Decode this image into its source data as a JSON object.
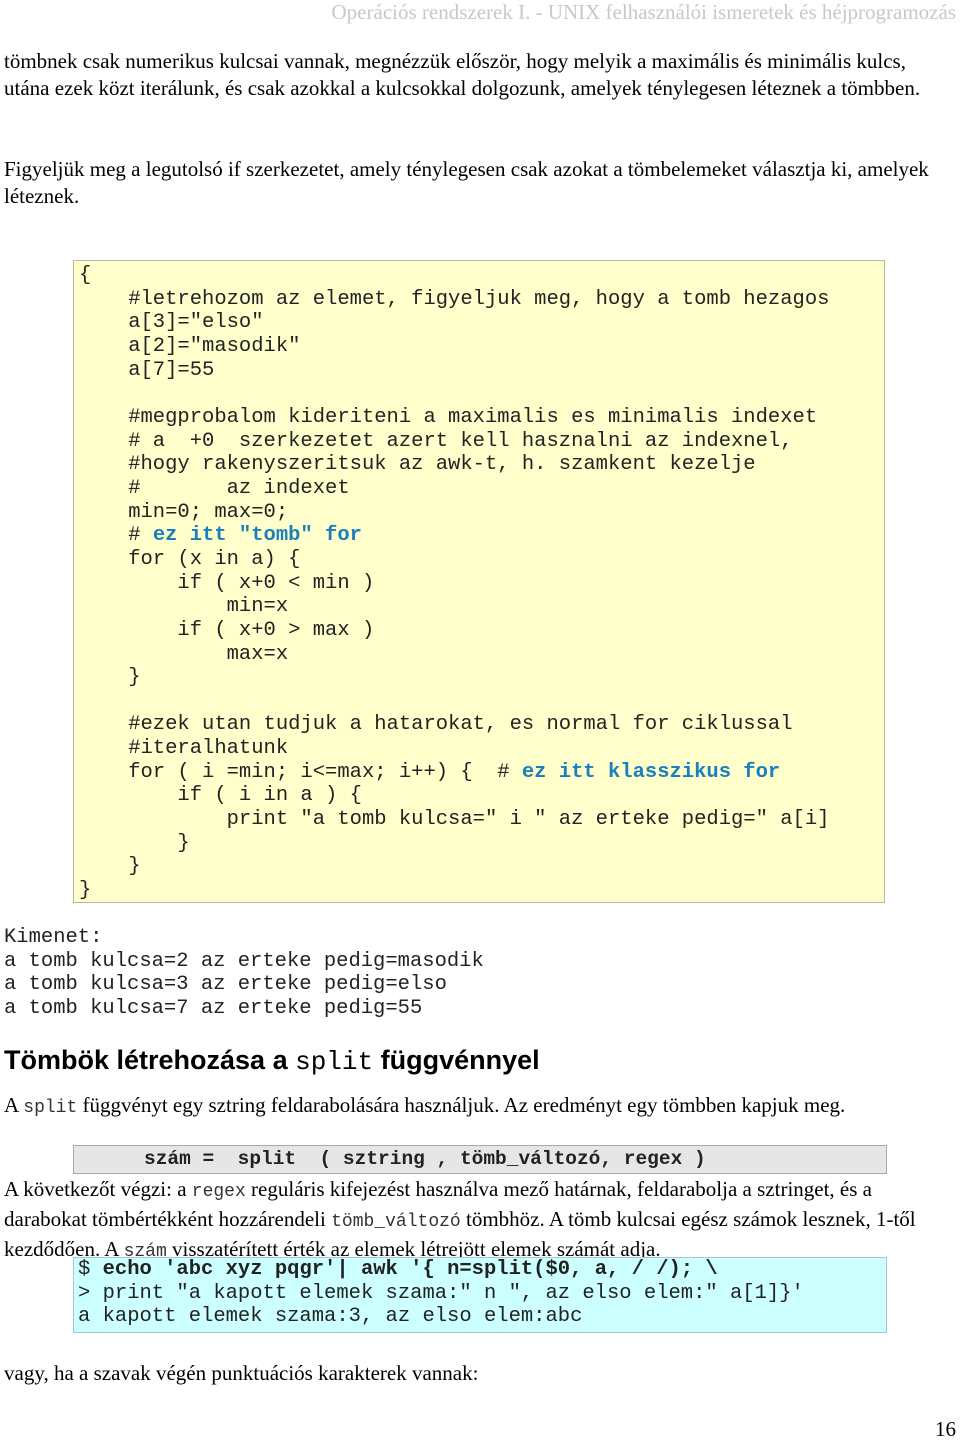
{
  "header": {
    "running_title": "Operációs rendszerek I. - UNIX felhasználói ismeretek és héjprogramozás"
  },
  "intro": {
    "paragraph1": "tömbnek csak numerikus kulcsai vannak, megnézzük először, hogy melyik a maximális és minimális kulcs, utána ezek közt iterálunk, és csak azokkal a kulcsokkal dolgozunk, amelyek ténylegesen léteznek a tömbben.",
    "paragraph2": "Figyeljük meg a legutolsó if szerkezetet, amely ténylegesen csak azokat a tömbelemeket választja ki, amelyek léteznek."
  },
  "code_example": {
    "lines": [
      "{",
      "    #letrehozom az elemet, figyeljuk meg, hogy a tomb hezagos",
      "    a[3]=\"elso\"",
      "    a[2]=\"masodik\"",
      "    a[7]=55",
      "",
      "    #megprobalom kideriteni a maximalis es minimalis indexet",
      "    # a  +0  szerkezetet azert kell hasznalni az indexnel,",
      "    #hogy rakenyszeritsuk az awk-t, h. szamkent kezelje",
      "    #       az indexet",
      "    min=0; max=0;",
      "    # ",
      "    for (x in a) {",
      "        if ( x+0 < min )",
      "            min=x",
      "        if ( x+0 > max )",
      "            max=x",
      "    }",
      "",
      "    #ezek utan tudjuk a hatarokat, es normal for ciklussal",
      "    #iteralhatunk",
      "    for ( i =min; i<=max; i++) {  # ",
      "        if ( i in a ) {",
      "            print \"a tomb kulcsa=\" i \" az erteke pedig=\" a[i]",
      "        }",
      "    }",
      "}"
    ],
    "highlight_comment_1": "ez itt \"tomb\" for",
    "highlight_comment_2": "ez itt klasszikus for",
    "highlight_color": "#1a7fbf"
  },
  "output": {
    "label": "Kimenet:",
    "lines": [
      "a tomb kulcsa=2 az erteke pedig=masodik",
      "a tomb kulcsa=3 az erteke pedig=elso",
      "a tomb kulcsa=7 az erteke pedig=55"
    ]
  },
  "section": {
    "title_before": "Tömbök létrehozása a ",
    "title_code": "split",
    "title_after": " függvénnyel",
    "p1_before": "A ",
    "p1_code": "split",
    "p1_after": " függvényt egy sztring feldarabolására használjuk. Az eredményt egy tömbben kapjuk meg.",
    "syntax": "szám =  split  ( sztring , tömb_változó, regex )",
    "p2_a": "A következőt végzi: a ",
    "p2_code1": "regex",
    "p2_b": " reguláris kifejezést használva mező határnak, feldarabolja a sztringet, és a darabokat tömbértékként hozzárendeli ",
    "p2_code2": "tömb_változó",
    "p2_c": " tömbhöz. A tömb  kulcsai egész számok lesznek, 1-től kezdődően. A ",
    "p2_code3": "szám",
    "p2_d": " visszatérített érték az elemek létrejött elemek számát adja.",
    "shell": {
      "prompt": "$ ",
      "command_bold": "echo 'abc xyz pqgr'| awk '{ n=split($0, a, / /); \\",
      "continuation": "> print \"a kapott elemek szama:\" n \", az elso elem:\" a[1]}'",
      "result": "a kapott elemek szama:3, az elso elem:abc"
    },
    "p3": "vagy,  ha a szavak végén punktuációs karakterek vannak:"
  },
  "footer": {
    "page_number": "16"
  },
  "colors": {
    "code_background": "#ffffcc",
    "syntax_background": "#e6e6e6",
    "shell_background": "#ccffff"
  }
}
